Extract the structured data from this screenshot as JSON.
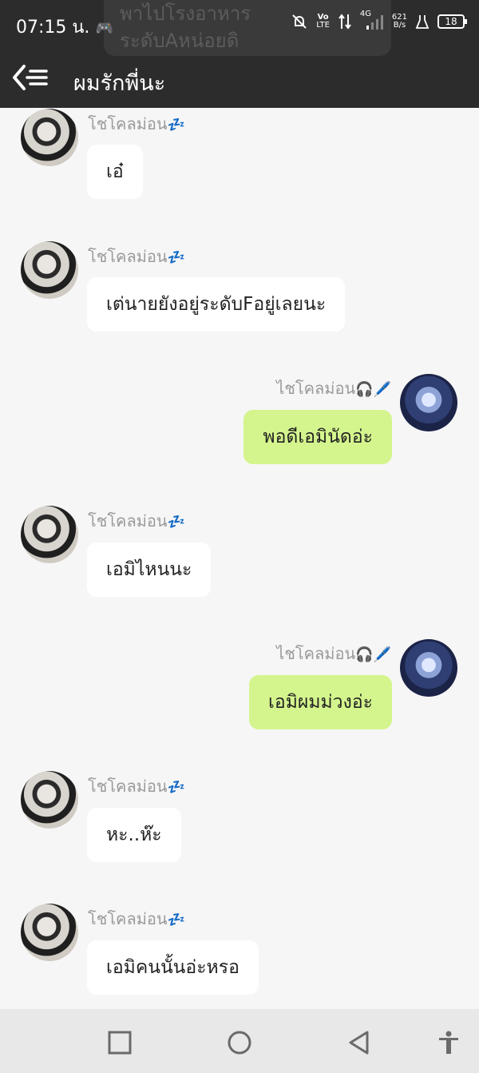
{
  "status_bar": {
    "time": "07:15 น.",
    "net_speed": "621",
    "net_unit": "B/s",
    "volte_top": "Vo",
    "volte_bottom": "LTE",
    "network": "4G",
    "battery": "18"
  },
  "overlay_preview": {
    "line1": "พาไปโรงอาหาร",
    "line2": "ระดับAหน่อยดิ"
  },
  "header": {
    "title": "ผมรักพี่นะ"
  },
  "sender_names": {
    "left": "โชโคลม่อน",
    "left_emoji": "💤",
    "right": "ไชโคลม่อน",
    "right_emoji": "🎧🖊️"
  },
  "messages": [
    {
      "side": "left",
      "text": "เอ๋"
    },
    {
      "side": "left",
      "text": "เต่นายยังอยู่ระดับFอยู่เลยนะ"
    },
    {
      "side": "right",
      "text": "พอดีเอมินัดอ่ะ"
    },
    {
      "side": "left",
      "text": "เอมิไหนนะ"
    },
    {
      "side": "right",
      "text": "เอมิผมม่วงอ่ะ"
    },
    {
      "side": "left",
      "text": "หะ..ห๊ะ"
    },
    {
      "side": "left",
      "text": "เอมิคนนั้นอ่ะหรอ"
    }
  ],
  "nav_icons": [
    "recents-square-icon",
    "home-circle-icon",
    "back-triangle-icon",
    "accessibility-icon"
  ]
}
